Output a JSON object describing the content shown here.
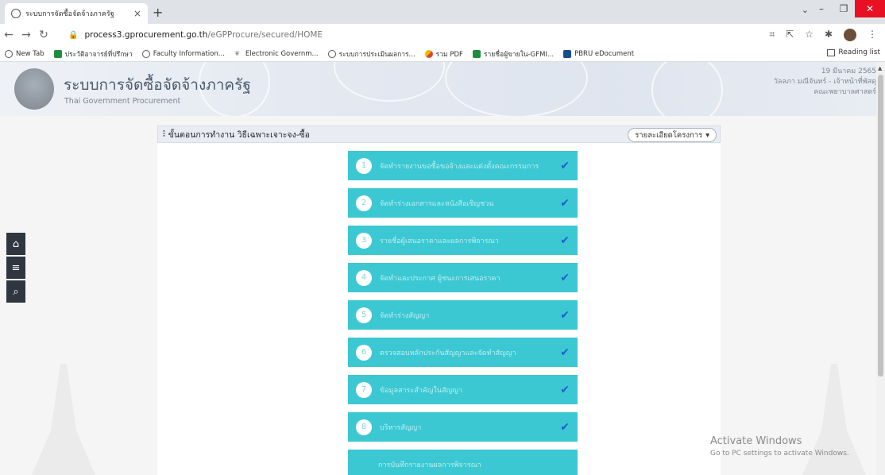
{
  "browser": {
    "tab_title": "ระบบการจัดซื้อจัดจ้างภาครัฐ",
    "url_host": "process3.gprocurement.go.th",
    "url_path": "/eGPProcure/secured/HOME",
    "bookmarks": [
      {
        "label": "New Tab",
        "icon": "globe-icon"
      },
      {
        "label": "ประวัติอาจารย์ที่ปรึกษา",
        "icon": "green-doc-icon"
      },
      {
        "label": "Faculty Information...",
        "icon": "globe-icon"
      },
      {
        "label": "Electronic Governm...",
        "icon": "leaf-icon"
      },
      {
        "label": "ระบบการประเมินผลการ...",
        "icon": "globe-icon"
      },
      {
        "label": "รวม PDF",
        "icon": "pdf-icon"
      },
      {
        "label": "รายชื่อผู้ขายใน-GFMI...",
        "icon": "green-doc-icon"
      },
      {
        "label": "PBRU eDocument",
        "icon": "blue-doc-icon"
      }
    ],
    "reading_list": "Reading list"
  },
  "header": {
    "site_title": "ระบบการจัดซื้อจัดจ้างภาครัฐ",
    "site_subtitle": "Thai Government Procurement",
    "date": "19 มีนาคม 2565",
    "user": "วัลลภา มณีจันทร์ - เจ้าหน้าที่พัสดุ",
    "department": "คณะพยาบาลศาสตร์"
  },
  "panel": {
    "title": "ขั้นตอนการทำงาน วิธีเฉพาะเจาะจง-ซื้อ",
    "detail_button": "รายละเอียดโครงการ"
  },
  "steps": [
    {
      "num": "1",
      "label": "จัดทำรายงานขอซื้อขอจ้างและแต่งตั้งคณะกรรมการ",
      "done": true
    },
    {
      "num": "2",
      "label": "จัดทำร่างเอกสารและหนังสือเชิญชวน",
      "done": true
    },
    {
      "num": "3",
      "label": "รายชื่อผู้เสนอราคาและผลการพิจารณา",
      "done": true
    },
    {
      "num": "4",
      "label": "จัดทำและประกาศ ผู้ชนะการเสนอราคา",
      "done": true
    },
    {
      "num": "5",
      "label": "จัดทำร่างสัญญา",
      "done": true
    },
    {
      "num": "6",
      "label": "ตรวจสอบหลักประกันสัญญาและจัดทำสัญญา",
      "done": true
    },
    {
      "num": "7",
      "label": "ข้อมูลสาระสำคัญในสัญญา",
      "done": true
    },
    {
      "num": "8",
      "label": "บริหารสัญญา",
      "done": true
    },
    {
      "num": "",
      "label": "การบันทึกรายงานผลการพิจารณา",
      "done": false
    }
  ],
  "watermark": {
    "line1": "Activate Windows",
    "line2": "Go to PC settings to activate Windows."
  },
  "colors": {
    "step_bg": "#3bc8d3",
    "check": "#1f5fd1",
    "close_btn": "#e81123"
  }
}
